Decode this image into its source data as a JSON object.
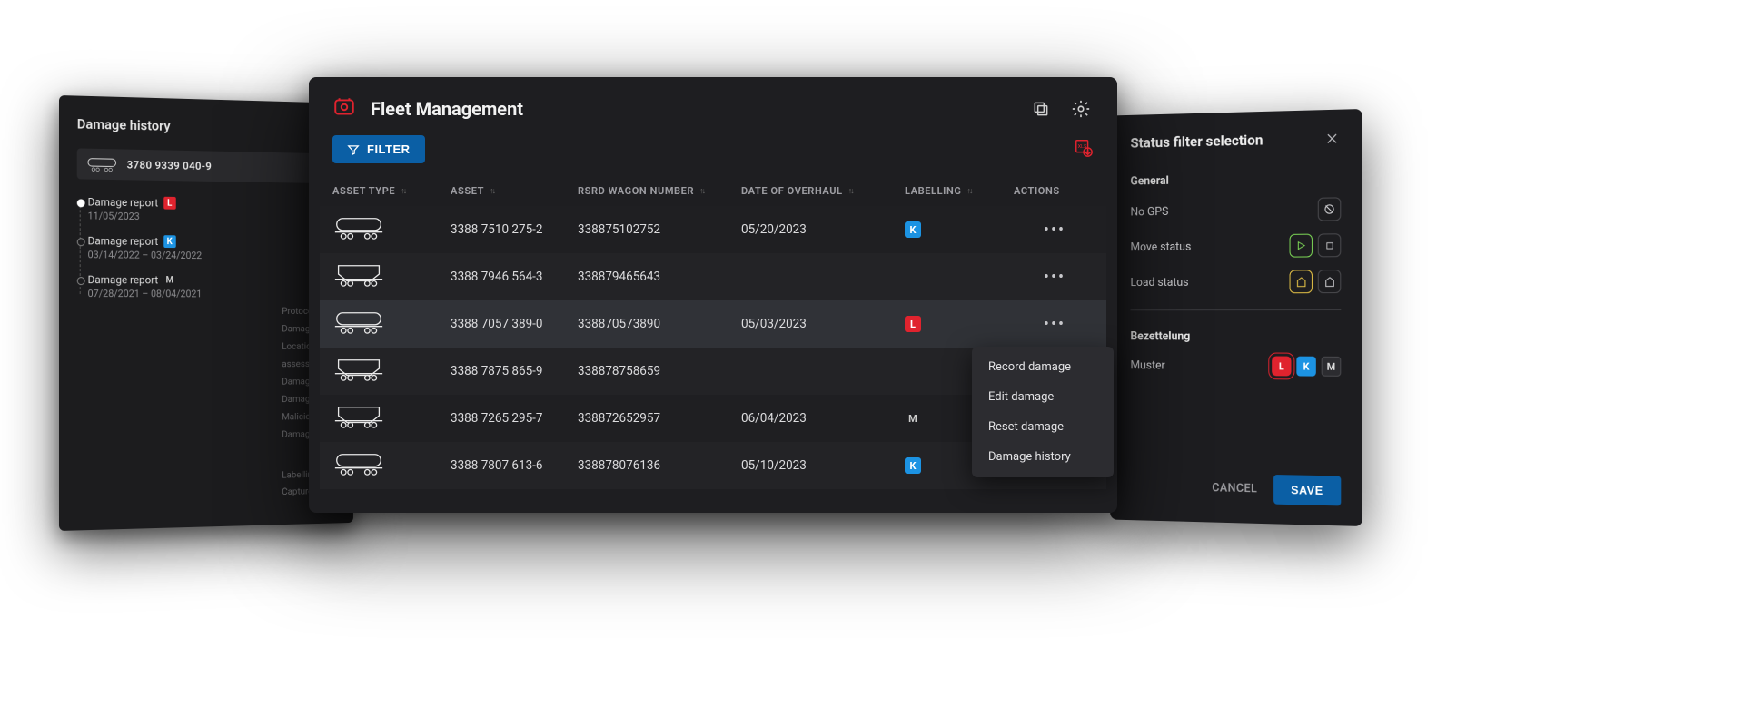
{
  "left": {
    "title": "Damage history",
    "wagon_number": "3780 9339 040-9",
    "timeline": [
      {
        "title": "Damage report",
        "badge": "L",
        "dates": "11/05/2023"
      },
      {
        "title": "Damage report",
        "badge": "K",
        "dates": "03/14/2022 – 03/24/2022"
      },
      {
        "title": "Damage report",
        "badge": "M",
        "dates": "07/28/2021 – 08/04/2021"
      }
    ],
    "meta_fields": [
      "Protocol no.",
      "Damage reporte",
      "Location of dam",
      "assessment",
      "Damage detecte",
      "Damage dealer",
      "Malicious code",
      "Damage descrip",
      "",
      "Labelling",
      "Capturer damag"
    ]
  },
  "center": {
    "title": "Fleet Management",
    "filter_label": "FILTER",
    "columns": {
      "asset_type": "ASSET TYPE",
      "asset": "ASSET",
      "rsrd": "RSRD WAGON NUMBER",
      "overhaul": "DATE OF OVERHAUL",
      "labelling": "LABELLING",
      "actions": "ACTIONS"
    },
    "rows": [
      {
        "type": "tank",
        "asset": "3388 7510 275-2",
        "rsrd": "338875102752",
        "overhaul": "05/20/2023",
        "label": "K"
      },
      {
        "type": "hopper",
        "asset": "3388 7946 564-3",
        "rsrd": "338879465643",
        "overhaul": "",
        "label": ""
      },
      {
        "type": "tank",
        "asset": "3388 7057 389-0",
        "rsrd": "338870573890",
        "overhaul": "05/03/2023",
        "label": "L",
        "hl": true
      },
      {
        "type": "hopper",
        "asset": "3388 7875 865-9",
        "rsrd": "338878758659",
        "overhaul": "",
        "label": ""
      },
      {
        "type": "hopper",
        "asset": "3388 7265 295-7",
        "rsrd": "338872652957",
        "overhaul": "06/04/2023",
        "label": "M"
      },
      {
        "type": "tank",
        "asset": "3388 7807 613-6",
        "rsrd": "338878076136",
        "overhaul": "05/10/2023",
        "label": "K"
      }
    ],
    "ctx": {
      "record": "Record damage",
      "edit": "Edit damage",
      "reset": "Reset damage",
      "history": "Damage history"
    }
  },
  "right": {
    "title": "Status filter selection",
    "section_general": "General",
    "no_gps": "No GPS",
    "move_status": "Move status",
    "load_status": "Load status",
    "section_bezettelung": "Bezettelung",
    "muster": "Muster",
    "cancel": "CANCEL",
    "save": "SAVE"
  }
}
